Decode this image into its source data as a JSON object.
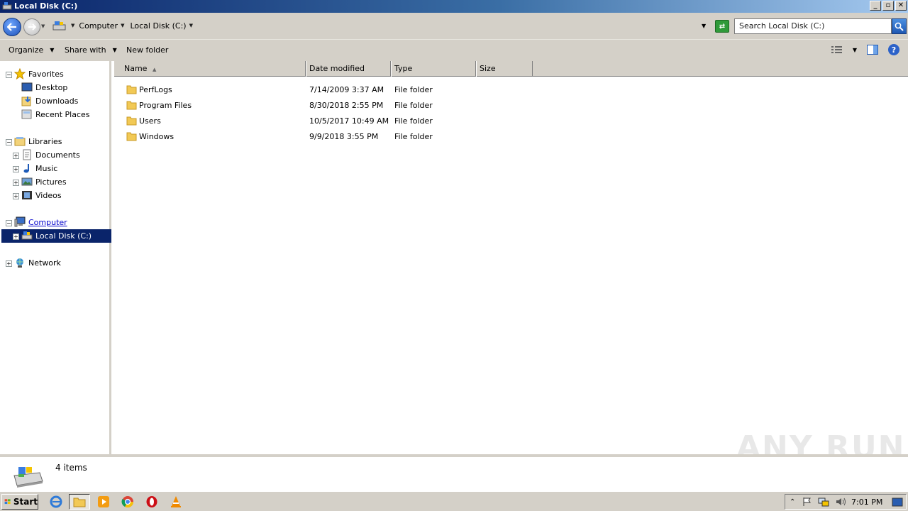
{
  "window": {
    "title": "Local Disk (C:)"
  },
  "address": {
    "crumbs": [
      "Computer",
      "Local Disk (C:)"
    ],
    "search_placeholder": "Search Local Disk (C:)"
  },
  "toolbar": {
    "organize": "Organize",
    "share_with": "Share with",
    "new_folder": "New folder"
  },
  "nav": {
    "favorites": "Favorites",
    "desktop": "Desktop",
    "downloads": "Downloads",
    "recent_places": "Recent Places",
    "libraries": "Libraries",
    "documents": "Documents",
    "music": "Music",
    "pictures": "Pictures",
    "videos": "Videos",
    "computer": "Computer",
    "local_disk": "Local Disk (C:)",
    "network": "Network"
  },
  "columns": {
    "name": "Name",
    "date": "Date modified",
    "type": "Type",
    "size": "Size"
  },
  "files": [
    {
      "name": "PerfLogs",
      "date": "7/14/2009 3:37 AM",
      "type": "File folder"
    },
    {
      "name": "Program Files",
      "date": "8/30/2018 2:55 PM",
      "type": "File folder"
    },
    {
      "name": "Users",
      "date": "10/5/2017 10:49 AM",
      "type": "File folder"
    },
    {
      "name": "Windows",
      "date": "9/9/2018 3:55 PM",
      "type": "File folder"
    }
  ],
  "status": {
    "count": "4 items"
  },
  "watermark": "ANY RUN",
  "taskbar": {
    "start": "Start",
    "clock": "7:01 PM"
  }
}
